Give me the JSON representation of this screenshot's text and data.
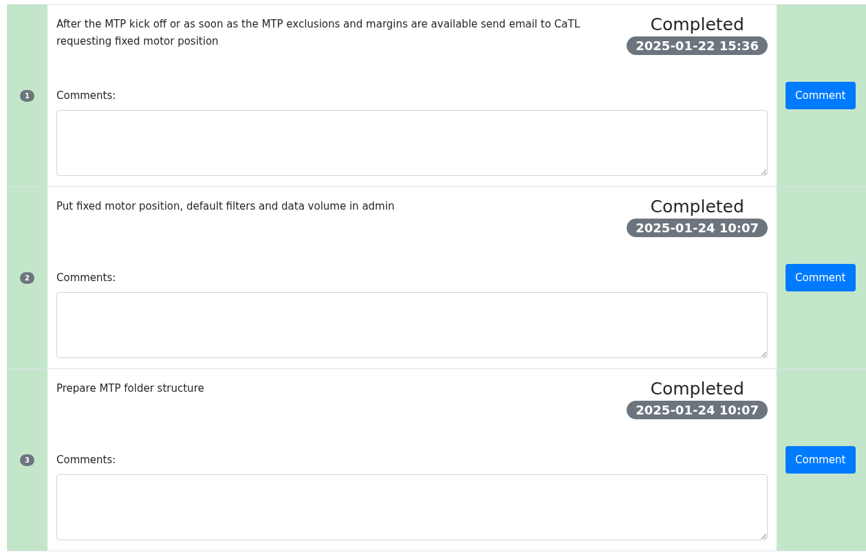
{
  "tasks": [
    {
      "number": "1",
      "description": "After the MTP kick off or as soon as the MTP exclusions and margins are available send email to CaTL requesting fixed motor position",
      "status": "Completed",
      "timestamp": "2025-01-22 15:36",
      "comments_label": "Comments:",
      "button": "Comment"
    },
    {
      "number": "2",
      "description": "Put fixed motor position, default filters and data volume in admin",
      "status": "Completed",
      "timestamp": "2025-01-24 10:07",
      "comments_label": "Comments:",
      "button": "Comment"
    },
    {
      "number": "3",
      "description": "Prepare MTP folder structure",
      "status": "Completed",
      "timestamp": "2025-01-24 10:07",
      "comments_label": "Comments:",
      "button": "Comment"
    }
  ]
}
